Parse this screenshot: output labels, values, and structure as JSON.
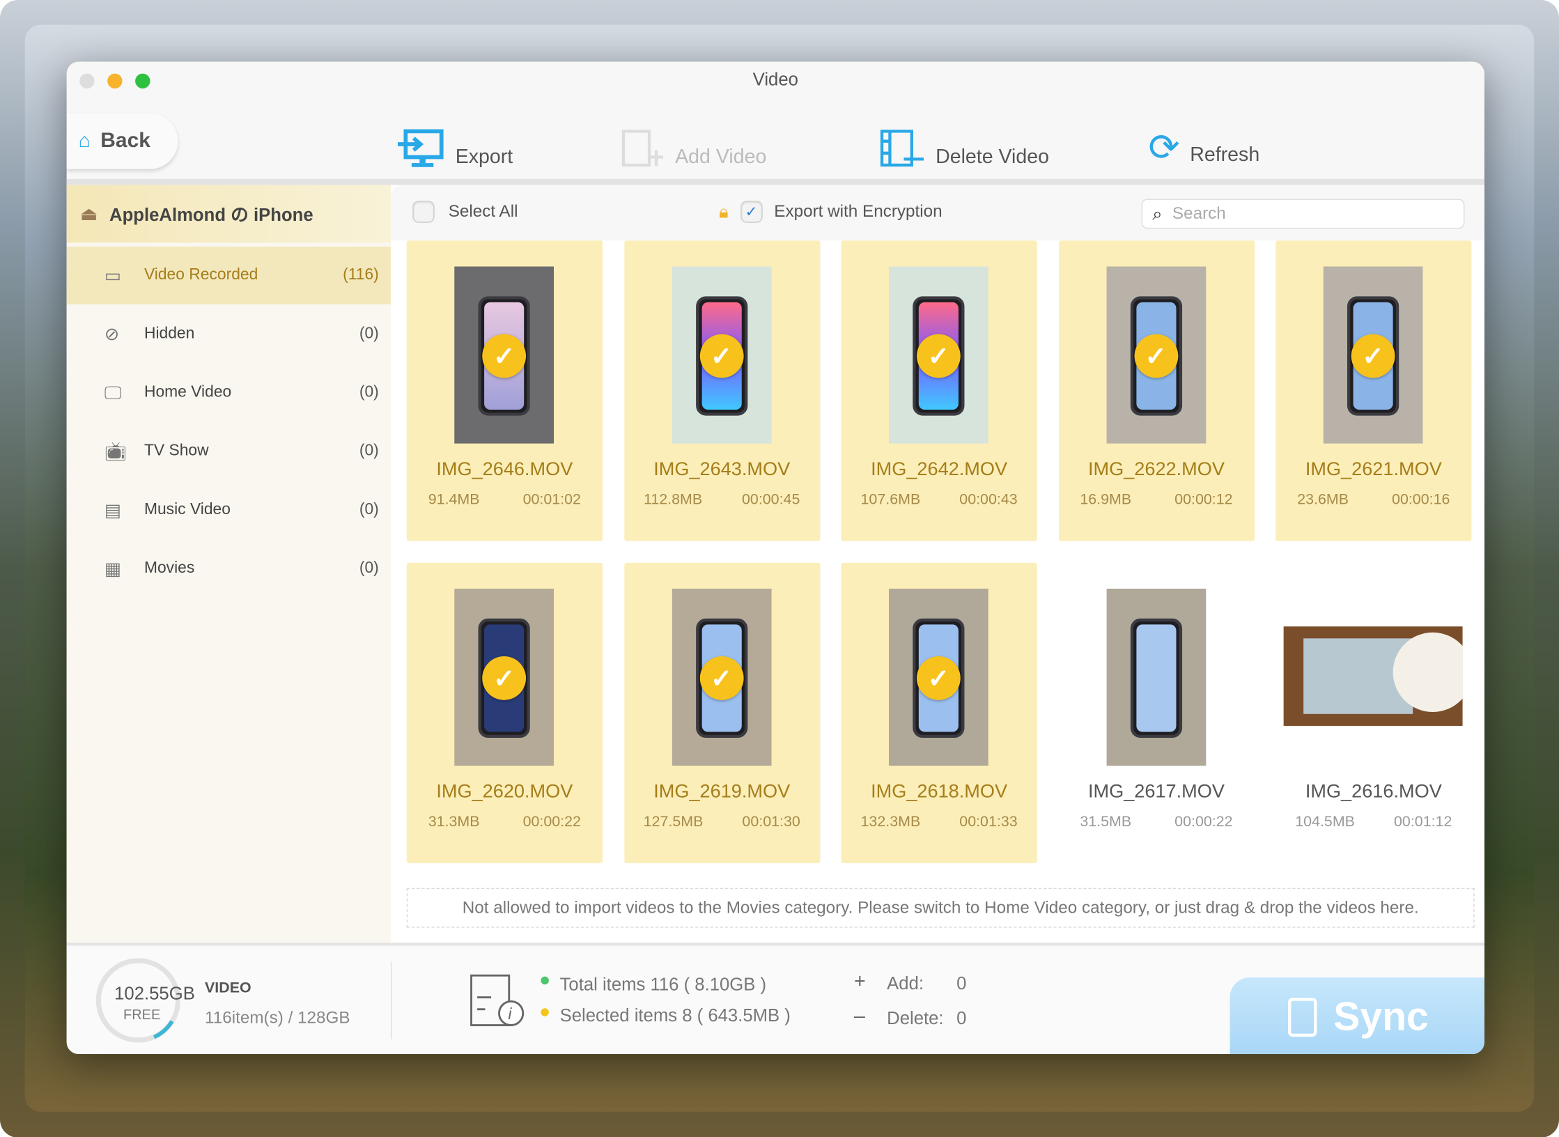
{
  "window": {
    "title": "Video"
  },
  "toolbar": {
    "back": "Back",
    "export": "Export",
    "add_video": "Add Video",
    "delete_video": "Delete Video",
    "refresh": "Refresh"
  },
  "sidebar": {
    "device": "AppleAlmond の iPhone",
    "items": [
      {
        "label": "Video Recorded",
        "count": "(116)",
        "icon": "video-camera-icon"
      },
      {
        "label": "Hidden",
        "count": "(0)",
        "icon": "eye-slash-icon"
      },
      {
        "label": "Home Video",
        "count": "(0)",
        "icon": "monitor-icon"
      },
      {
        "label": "TV Show",
        "count": "(0)",
        "icon": "tv-icon"
      },
      {
        "label": "Music Video",
        "count": "(0)",
        "icon": "music-film-icon"
      },
      {
        "label": "Movies",
        "count": "(0)",
        "icon": "film-icon"
      }
    ]
  },
  "header": {
    "select_all": "Select All",
    "export_encryption": "Export with Encryption",
    "encryption_checked": true,
    "search_placeholder": "Search"
  },
  "videos": [
    {
      "name": "IMG_2646.MOV",
      "size": "91.4MB",
      "duration": "00:01:02",
      "selected": true
    },
    {
      "name": "IMG_2643.MOV",
      "size": "112.8MB",
      "duration": "00:00:45",
      "selected": true
    },
    {
      "name": "IMG_2642.MOV",
      "size": "107.6MB",
      "duration": "00:00:43",
      "selected": true
    },
    {
      "name": "IMG_2622.MOV",
      "size": "16.9MB",
      "duration": "00:00:12",
      "selected": true
    },
    {
      "name": "IMG_2621.MOV",
      "size": "23.6MB",
      "duration": "00:00:16",
      "selected": true
    },
    {
      "name": "IMG_2620.MOV",
      "size": "31.3MB",
      "duration": "00:00:22",
      "selected": true
    },
    {
      "name": "IMG_2619.MOV",
      "size": "127.5MB",
      "duration": "00:01:30",
      "selected": true
    },
    {
      "name": "IMG_2618.MOV",
      "size": "132.3MB",
      "duration": "00:01:33",
      "selected": true
    },
    {
      "name": "IMG_2617.MOV",
      "size": "31.5MB",
      "duration": "00:00:22",
      "selected": false
    },
    {
      "name": "IMG_2616.MOV",
      "size": "104.5MB",
      "duration": "00:01:12",
      "selected": false
    }
  ],
  "notice": "Not allowed to  import videos to the Movies category. Please switch to Home Video category, or just drag & drop the videos here.",
  "footer": {
    "free": "102.55GB",
    "free_label": "FREE",
    "category": "VIDEO",
    "capacity": "116item(s) / 128GB",
    "total": "Total items 116 ( 8.10GB )",
    "selected": "Selected items 8 ( 643.5MB )",
    "add_label": "Add:",
    "add_value": "0",
    "delete_label": "Delete:",
    "delete_value": "0",
    "sync": "Sync"
  },
  "colors": {
    "accent": "#a57d1a",
    "check": "#f8c21c",
    "sync": "#a8d6f7"
  }
}
